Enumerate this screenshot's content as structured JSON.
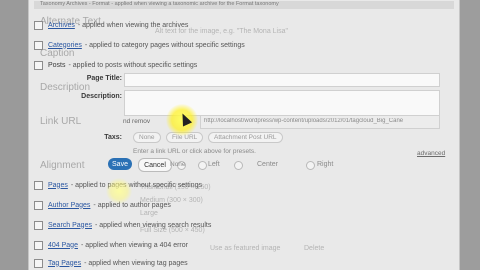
{
  "top_strip": "Taxonomy Archives - Format - applied when viewing a taxonomic archive for the Format taxonomy",
  "archive_rows": [
    {
      "link": "Archives",
      "desc": "- applied when viewing the archives"
    },
    {
      "link": "Categories",
      "desc": "- applied to category pages without specific settings"
    },
    {
      "link": "Posts",
      "desc": "- applied to posts without specific settings"
    }
  ],
  "ghost_labels": {
    "alternate_text": "Alternate Text",
    "caption": "Caption",
    "description": "Description",
    "link_url": "Link URL",
    "alignment": "Alignment",
    "alt_text_hint": "Alt text for the image, e.g. \"The Mona Lisa\""
  },
  "form": {
    "page_title_label": "Page Title:",
    "description_label": "Description:",
    "taxs_label": "Taxs:",
    "url_value": "http://localhost/wordpress/wp-content/uploads/2012/01/tagcloud_Big_Cane",
    "url_hint": "Enter a link URL or click above for presets.",
    "url_prefix": "nd remov",
    "advanced_link": "advanced",
    "link_presets": [
      "None",
      "File URL",
      "Attachment Post URL"
    ],
    "alignment_options": [
      "None",
      "Left",
      "Center",
      "Right"
    ],
    "save_label": "Save",
    "cancel_label": "Cancel"
  },
  "lower_rows": [
    {
      "link": "Pages",
      "desc": "- applied to pages without specific settings"
    },
    {
      "link": "Author Pages",
      "desc": "- applied to author pages"
    },
    {
      "link": "Search Pages",
      "desc": "- applied when viewing search results"
    },
    {
      "link": "404 Page",
      "desc": "- applied when viewing a 404 error"
    },
    {
      "link": "Tag Pages",
      "desc": "- applied when viewing tag pages"
    }
  ],
  "size_ghosts": {
    "thumbnail": "Thumbnail (150 × 150)",
    "medium": "Medium (300 × 300)",
    "large": "Large",
    "full_size": "Full Size (500 × 450)"
  },
  "bottom_ghosts": {
    "use_featured": "Use as featured image",
    "delete": "Delete"
  }
}
